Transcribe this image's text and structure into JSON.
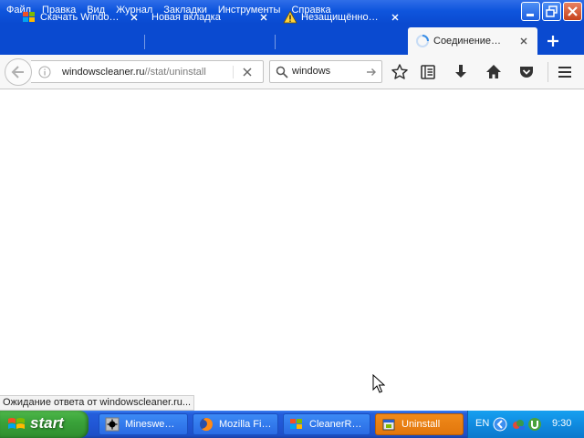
{
  "menu": {
    "items": [
      "Файл",
      "Правка",
      "Вид",
      "Журнал",
      "Закладки",
      "Инструменты",
      "Справка"
    ]
  },
  "tabs": [
    {
      "title": "Скачать Windo…",
      "icon": "windows-logo-icon",
      "active": false
    },
    {
      "title": "Новая вкладка",
      "icon": "none",
      "active": false
    },
    {
      "title": "Незащищённо…",
      "icon": "warning-icon",
      "active": false
    },
    {
      "title": "Соединение…",
      "icon": "loading-spinner-icon",
      "active": true
    }
  ],
  "navbar": {
    "url_host": "windowscleaner.ru",
    "url_path": "//stat/uninstall",
    "search_value": "windows"
  },
  "status_text": "Ожидание ответа от windowscleaner.ru...",
  "taskbar": {
    "start_label": "start",
    "tasks": [
      {
        "label": "Mineswe…",
        "icon": "minesweeper-icon",
        "active": false
      },
      {
        "label": "Mozilla Fi…",
        "icon": "firefox-icon",
        "active": false
      },
      {
        "label": "CleanerR…",
        "icon": "cleaner-icon",
        "active": false
      },
      {
        "label": "Uninstall",
        "icon": "uninstall-icon",
        "active": true
      }
    ],
    "tray": {
      "language": "EN",
      "clock": "9:30"
    }
  },
  "colors": {
    "xp_blue": "#0a4ad0",
    "start_green": "#3aa33a",
    "active_task_orange": "#e2760c",
    "tray_blue": "#0f8be0"
  }
}
